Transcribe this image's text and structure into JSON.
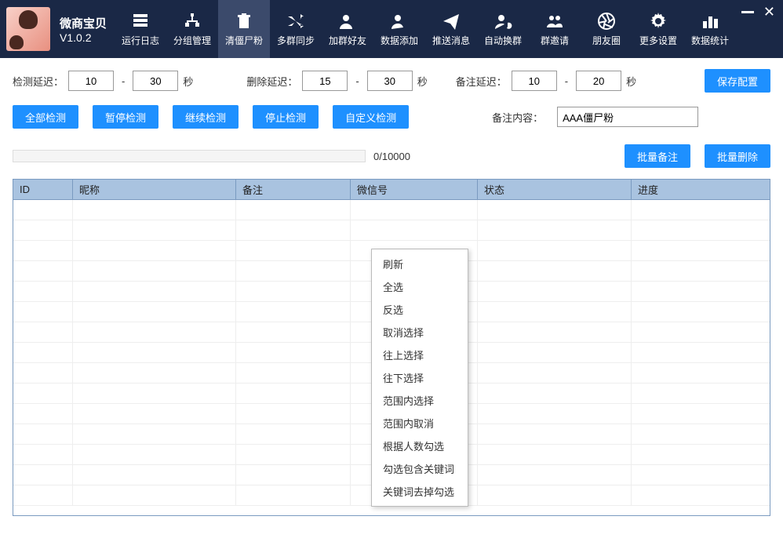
{
  "app": {
    "name": "微商宝贝",
    "version": "V1.0.2"
  },
  "toolbar": [
    {
      "label": "运行日志",
      "icon": "log"
    },
    {
      "label": "分组管理",
      "icon": "group"
    },
    {
      "label": "清僵尸粉",
      "icon": "clean",
      "active": true
    },
    {
      "label": "多群同步",
      "icon": "sync"
    },
    {
      "label": "加群好友",
      "icon": "addfriend"
    },
    {
      "label": "数据添加",
      "icon": "dataadd"
    },
    {
      "label": "推送消息",
      "icon": "push"
    },
    {
      "label": "自动换群",
      "icon": "autoswap"
    },
    {
      "label": "群邀请",
      "icon": "invite"
    },
    {
      "label": "朋友圈",
      "icon": "moments"
    },
    {
      "label": "更多设置",
      "icon": "settings"
    },
    {
      "label": "数据统计",
      "icon": "stats"
    }
  ],
  "config": {
    "detect_label": "检测延迟：",
    "detect_min": "10",
    "detect_max": "30",
    "delete_label": "删除延迟：",
    "delete_min": "15",
    "delete_max": "30",
    "remark_label": "备注延迟：",
    "remark_min": "10",
    "remark_max": "20",
    "unit": "秒",
    "dash": "-",
    "save_btn": "保存配置"
  },
  "actions": {
    "detect_all": "全部检测",
    "pause": "暂停检测",
    "resume": "继续检测",
    "stop": "停止检测",
    "custom": "自定义检测",
    "remark_content_label": "备注内容：",
    "remark_value": "AAA僵尸粉"
  },
  "progress": {
    "text": "0/10000",
    "batch_remark": "批量备注",
    "batch_delete": "批量删除"
  },
  "table": {
    "headers": {
      "id": "ID",
      "nick": "昵称",
      "remark": "备注",
      "wxid": "微信号",
      "status": "状态",
      "progress": "进度"
    }
  },
  "context_menu": [
    "刷新",
    "全选",
    "反选",
    "取消选择",
    "往上选择",
    "往下选择",
    "范围内选择",
    "范围内取消",
    "根据人数勾选",
    "勾选包含关键词",
    "关键词去掉勾选"
  ]
}
